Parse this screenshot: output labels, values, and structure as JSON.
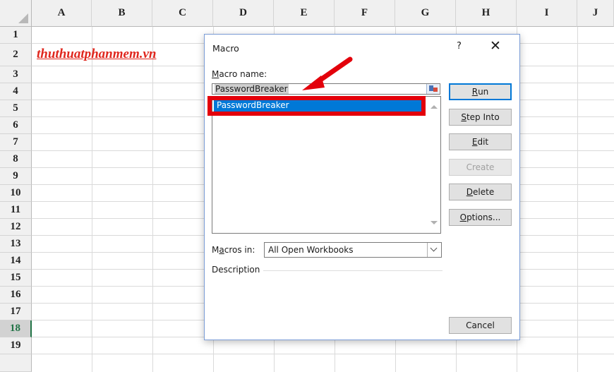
{
  "sheet": {
    "columns": [
      "A",
      "B",
      "C",
      "D",
      "E",
      "F",
      "G",
      "H",
      "I",
      "J"
    ],
    "rows": [
      "1",
      "2",
      "3",
      "4",
      "5",
      "6",
      "7",
      "8",
      "9",
      "10",
      "11",
      "12",
      "13",
      "14",
      "15",
      "16",
      "17",
      "18",
      "19"
    ],
    "selected_row": "18",
    "cell_A2": "thuthuatphanmem.vn"
  },
  "dialog": {
    "title": "Macro",
    "help": "?",
    "close": "✕",
    "macro_name_label_underlined": "M",
    "macro_name_label_rest": "acro name:",
    "macro_name_value": "PasswordBreaker",
    "macro_list": [
      "PasswordBreaker"
    ],
    "macros_in_label_pre": "M",
    "macros_in_label_underlined": "a",
    "macros_in_label_rest": "cros in:",
    "macros_in_value": "All Open Workbooks",
    "description_label": "Description",
    "buttons": {
      "run_u": "R",
      "run_rest": "un",
      "step_u": "S",
      "step_rest": "tep Into",
      "edit_u": "E",
      "edit_rest": "dit",
      "create": "Create",
      "delete_u": "D",
      "delete_rest": "elete",
      "options_u": "O",
      "options_rest": "ptions...",
      "cancel": "Cancel"
    }
  },
  "colors": {
    "highlight_box": "#e3000b",
    "selection": "#0078d7",
    "logo": "#e0261d"
  }
}
